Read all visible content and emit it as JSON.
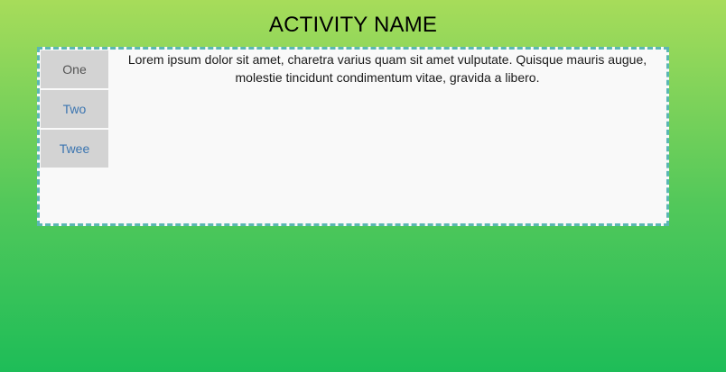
{
  "page": {
    "title": "ACTIVITY NAME"
  },
  "tabs": [
    {
      "label": "One"
    },
    {
      "label": "Two"
    },
    {
      "label": "Twee"
    }
  ],
  "content": {
    "text": "Lorem ipsum dolor sit amet, charetra varius quam sit amet vulputate. Quisque mauris augue, molestie tincidunt condimentum vitae, gravida a libero."
  },
  "colors": {
    "panel_border": "#5bb7b3",
    "tab_background": "#d3d3d3",
    "link_text": "#3a74b0"
  }
}
